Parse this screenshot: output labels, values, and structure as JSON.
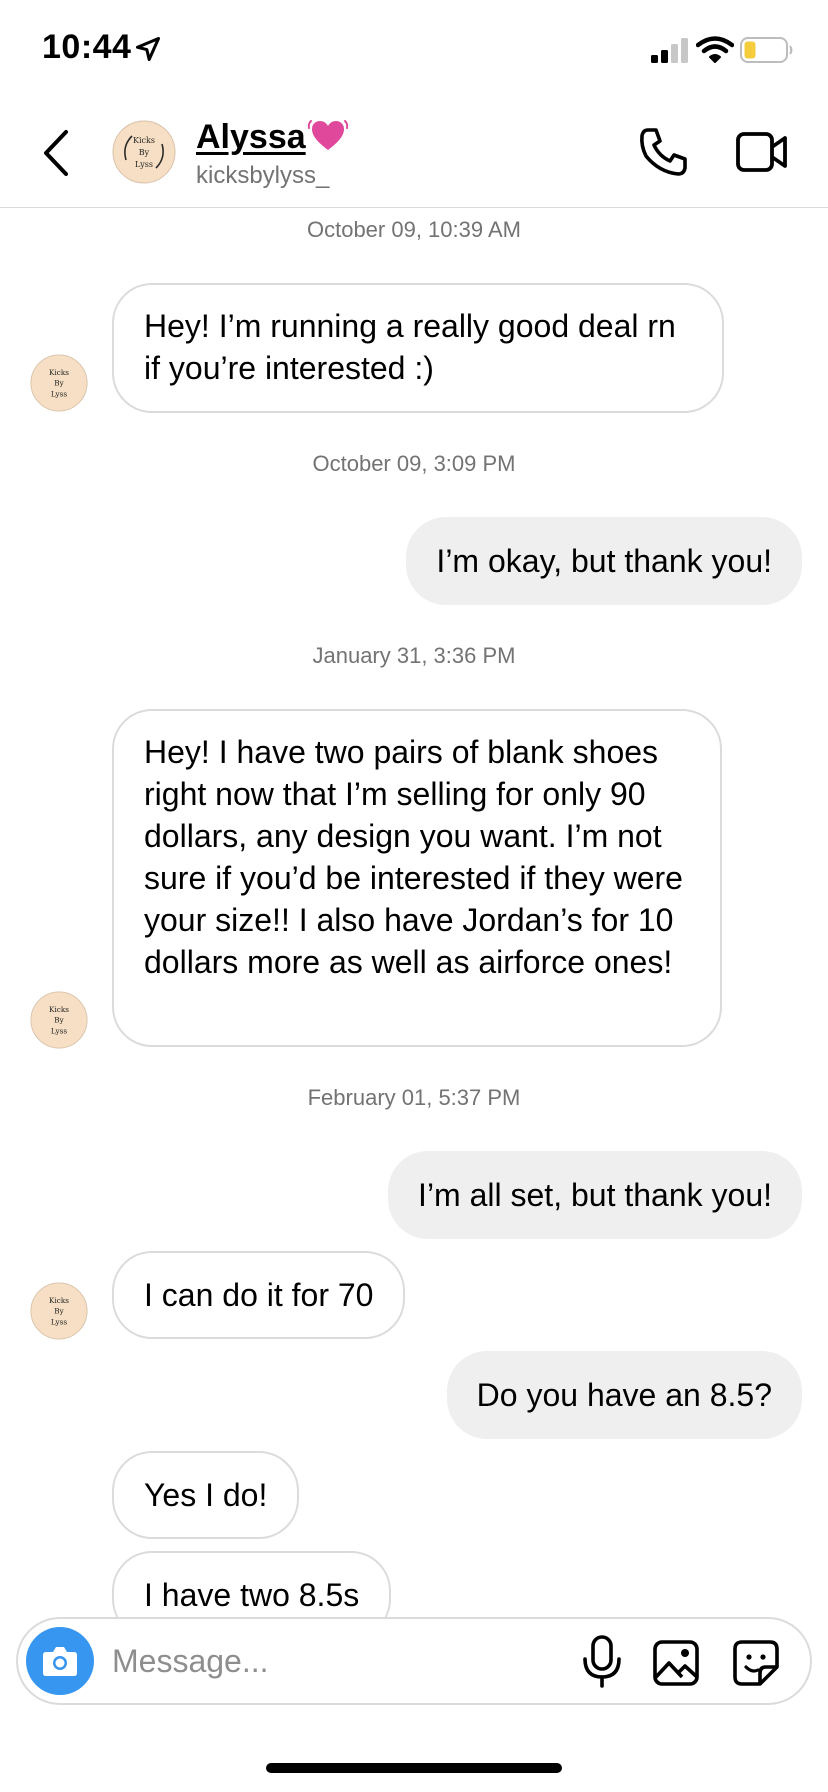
{
  "status_bar": {
    "time": "10:44"
  },
  "header": {
    "contact_name": "Alyssa",
    "username": "kicksbylyss_",
    "avatar_text": [
      "Kicks",
      "By",
      "Lyss"
    ]
  },
  "messages": [
    {
      "type": "timestamp",
      "text": "October 09, 10:39 AM"
    },
    {
      "type": "incoming",
      "text": "Hey! I’m running a really good deal rn if you’re interested :)"
    },
    {
      "type": "timestamp",
      "text": "October 09, 3:09 PM"
    },
    {
      "type": "outgoing",
      "text": "I’m okay, but thank you!"
    },
    {
      "type": "timestamp",
      "text": "January 31, 3:36 PM"
    },
    {
      "type": "incoming",
      "text": "Hey! I have two pairs of blank shoes right now that I’m selling for only 90 dollars, any design you want. I’m not sure if you’d be interested if they were your size!! I also have Jordan’s for 10 dollars more as well as airforce ones!"
    },
    {
      "type": "timestamp",
      "text": "February 01, 5:37 PM"
    },
    {
      "type": "outgoing",
      "text": "I’m all set, but thank you!"
    },
    {
      "type": "incoming",
      "text": "I can do it for 70"
    },
    {
      "type": "outgoing",
      "text": "Do you have an 8.5?"
    },
    {
      "type": "incoming",
      "text": "Yes I do!"
    },
    {
      "type": "incoming",
      "text": "I have two 8.5s"
    }
  ],
  "composer": {
    "placeholder": "Message..."
  },
  "colors": {
    "accent": "#3797f0",
    "outgoing_bubble": "#efefef",
    "incoming_border": "#dbdbdb",
    "timestamp_text": "#737373",
    "avatar_bg": "#f6dfc4"
  }
}
